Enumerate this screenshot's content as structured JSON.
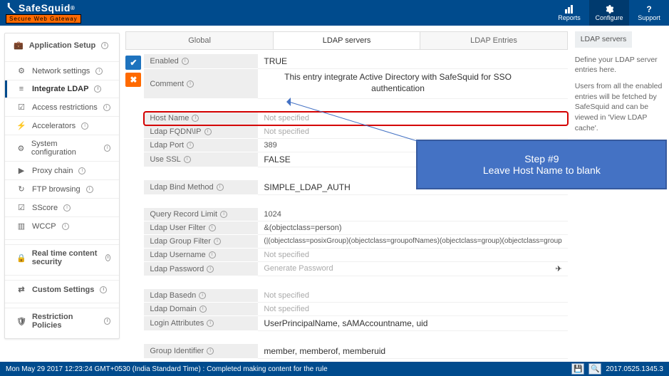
{
  "brand": {
    "name": "SafeSquid",
    "reg": "®",
    "tagline": "Secure Web Gateway"
  },
  "topnav": {
    "reports": "Reports",
    "configure": "Configure",
    "support": "Support"
  },
  "sidebar": {
    "heading": "Application Setup",
    "items": [
      {
        "icon": "⚙",
        "label": "Network settings"
      },
      {
        "icon": "≡",
        "label": "Integrate LDAP",
        "active": true
      },
      {
        "icon": "☑",
        "label": "Access restrictions"
      },
      {
        "icon": "⚡",
        "label": "Accelerators"
      },
      {
        "icon": "⚙",
        "label": "System configuration"
      },
      {
        "icon": "▶",
        "label": "Proxy chain"
      },
      {
        "icon": "↻",
        "label": "FTP browsing"
      },
      {
        "icon": "☑",
        "label": "SScore"
      },
      {
        "icon": "▥",
        "label": "WCCP"
      }
    ],
    "group2": [
      {
        "icon": "🔒",
        "label": "Real time content security"
      }
    ],
    "group3": [
      {
        "icon": "⇄",
        "label": "Custom Settings"
      }
    ],
    "group4": [
      {
        "icon": "🛡",
        "label": "Restriction Policies"
      }
    ]
  },
  "tabs": {
    "global": "Global",
    "servers": "LDAP servers",
    "entries": "LDAP Entries"
  },
  "form": {
    "enabled": {
      "label": "Enabled",
      "value": "TRUE"
    },
    "comment": {
      "label": "Comment",
      "value": "This entry integrate Active Directory with SafeSquid  for SSO authentication"
    },
    "host": {
      "label": "Host Name",
      "value": "Not specified"
    },
    "fqdn": {
      "label": "Ldap FQDN\\IP",
      "value": "Not specified"
    },
    "port": {
      "label": "Ldap Port",
      "value": "389"
    },
    "ssl": {
      "label": "Use SSL",
      "value": "FALSE"
    },
    "bind": {
      "label": "Ldap Bind Method",
      "value": "SIMPLE_LDAP_AUTH"
    },
    "qlimit": {
      "label": "Query Record Limit",
      "value": "1024"
    },
    "ufilter": {
      "label": "Ldap User Filter",
      "value": "&(objectclass=person)"
    },
    "gfilter": {
      "label": "Ldap Group Filter",
      "value": "(|(objectclass=posixGroup)(objectclass=groupofNames)(objectclass=group)(objectclass=group"
    },
    "uname": {
      "label": "Ldap Username",
      "value": "Not specified"
    },
    "pwd": {
      "label": "Ldap Password",
      "value": "Generate Password"
    },
    "basedn": {
      "label": "Ldap Basedn",
      "value": "Not specified"
    },
    "domain": {
      "label": "Ldap Domain",
      "value": "Not specified"
    },
    "login": {
      "label": "Login Attributes",
      "value": "UserPrincipalName,  sAMAccountname,  uid"
    },
    "gid": {
      "label": "Group Identifier",
      "value": "member,  memberof,  memberuid"
    }
  },
  "rightcol": {
    "button": "LDAP servers",
    "p1": "Define your LDAP server entries here.",
    "p2": "Users from all the enabled entries will be fetched by SafeSquid and can be viewed in 'View LDAP cache'."
  },
  "callout": {
    "title": "Step #9",
    "text": "Leave Host Name to blank"
  },
  "footer": {
    "left": "Mon May 29 2017 12:23:24 GMT+0530 (India Standard Time) : Completed making content for the rule",
    "version": "2017.0525.1345.3"
  }
}
